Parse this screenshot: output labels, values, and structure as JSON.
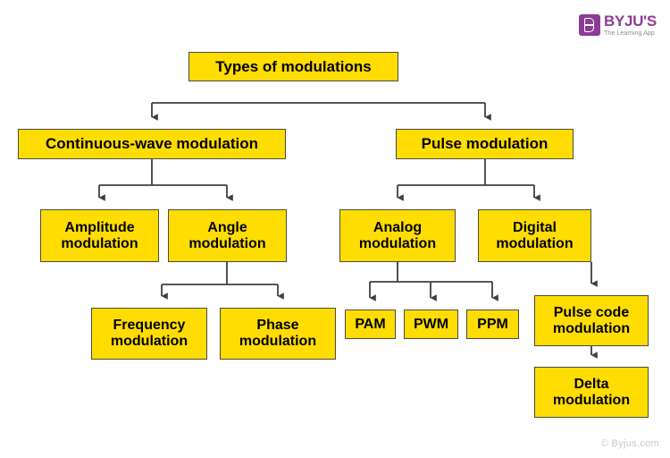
{
  "brand": {
    "logo_name": "BYJU'S",
    "logo_tagline": "The Learning App",
    "logo_color": "#8e3b96"
  },
  "diagram": {
    "type": "tree",
    "node_fill": "#ffdd00",
    "node_border": "#4a4a4a",
    "connector_color": "#3f3f3f",
    "nodes": {
      "root": "Types of modulations",
      "continuous_wave": "Continuous-wave modulation",
      "pulse": "Pulse modulation",
      "amplitude": "Amplitude modulation",
      "angle": "Angle modulation",
      "analog": "Analog modulation",
      "digital": "Digital modulation",
      "frequency": "Frequency modulation",
      "phase": "Phase modulation",
      "pam": "PAM",
      "pwm": "PWM",
      "ppm": "PPM",
      "pulse_code": "Pulse code modulation",
      "delta": "Delta modulation"
    },
    "edges": [
      {
        "from": "root",
        "to": "continuous_wave"
      },
      {
        "from": "root",
        "to": "pulse"
      },
      {
        "from": "continuous_wave",
        "to": "amplitude"
      },
      {
        "from": "continuous_wave",
        "to": "angle"
      },
      {
        "from": "pulse",
        "to": "analog"
      },
      {
        "from": "pulse",
        "to": "digital"
      },
      {
        "from": "angle",
        "to": "frequency"
      },
      {
        "from": "angle",
        "to": "phase"
      },
      {
        "from": "analog",
        "to": "pam"
      },
      {
        "from": "analog",
        "to": "pwm"
      },
      {
        "from": "analog",
        "to": "ppm"
      },
      {
        "from": "digital",
        "to": "pulse_code"
      },
      {
        "from": "pulse_code",
        "to": "delta"
      }
    ]
  },
  "footer": {
    "copyright": "© Byjus.com"
  }
}
